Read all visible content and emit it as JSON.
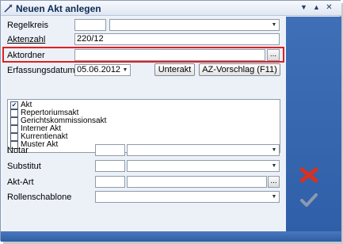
{
  "window": {
    "title": "Neuen Akt anlegen",
    "controls": [
      "▼",
      "▲",
      "✕"
    ]
  },
  "form": {
    "regelkreis": {
      "label": "Regelkreis",
      "value_short": "",
      "value_select": ""
    },
    "aktenzahl": {
      "label": "Aktenzahl",
      "value": "220/12"
    },
    "aktordner": {
      "label": "Aktordner",
      "value": "",
      "browse": "..."
    },
    "erfassungsdatum": {
      "label": "Erfassungsdatum",
      "value": "05.06.2012"
    },
    "buttons": {
      "unterakt": "Unterakt",
      "az_vorschlag": "AZ-Vorschlag (F11)"
    },
    "akt_types": [
      {
        "label": "Akt",
        "checked": true,
        "check_mark": "✔"
      },
      {
        "label": "Repertoriumsakt",
        "checked": false,
        "check_mark": ""
      },
      {
        "label": "Gerichtskommissionsakt",
        "checked": false,
        "check_mark": ""
      },
      {
        "label": "Interner Akt",
        "checked": false,
        "check_mark": ""
      },
      {
        "label": "Kurrentienakt",
        "checked": false,
        "check_mark": ""
      },
      {
        "label": "Muster Akt",
        "checked": false,
        "check_mark": ""
      }
    ],
    "notar": {
      "label": "Notar",
      "value_short": "",
      "value_select": ""
    },
    "substitut": {
      "label": "Substitut",
      "value_short": "",
      "value_select": ""
    },
    "akt_art": {
      "label": "Akt-Art",
      "value_short": "",
      "value_select": "",
      "browse": "..."
    },
    "rollenschablone": {
      "label": "Rollenschablone",
      "value": ""
    }
  },
  "colors": {
    "sidebar": "#3f6fb6",
    "cancel_icon": "#d9301f",
    "ok_icon": "#8a9ab0",
    "highlight": "#e02020"
  },
  "icons": {
    "cancel": "cancel-icon",
    "ok": "ok-icon"
  }
}
